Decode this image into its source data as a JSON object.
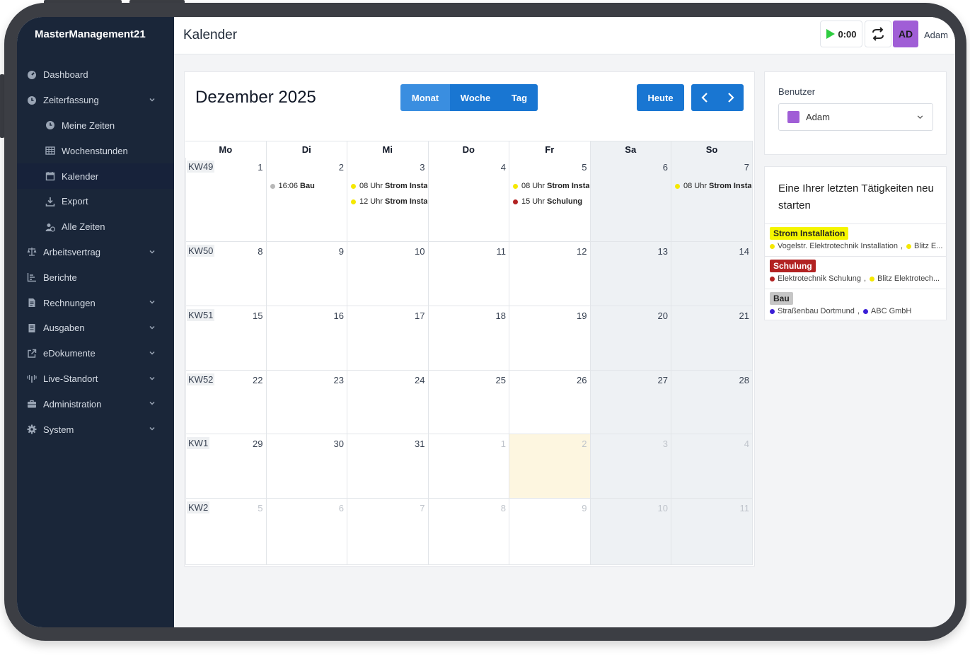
{
  "app": {
    "brand": "MasterManagement21",
    "page_title": "Kalender"
  },
  "sidebar": {
    "items": [
      {
        "label": "Dashboard",
        "icon": "dashboard-icon"
      },
      {
        "label": "Zeiterfassung",
        "icon": "clock-icon"
      },
      {
        "label": "Meine Zeiten",
        "icon": "clock-icon"
      },
      {
        "label": "Wochenstunden",
        "icon": "table-icon"
      },
      {
        "label": "Kalender",
        "icon": "calendar-icon"
      },
      {
        "label": "Export",
        "icon": "download-icon"
      },
      {
        "label": "Alle Zeiten",
        "icon": "users-icon"
      },
      {
        "label": "Arbeitsvertrag",
        "icon": "scale-icon"
      },
      {
        "label": "Berichte",
        "icon": "chart-icon"
      },
      {
        "label": "Rechnungen",
        "icon": "invoice-icon"
      },
      {
        "label": "Ausgaben",
        "icon": "receipt-icon"
      },
      {
        "label": "eDokumente",
        "icon": "external-link-icon"
      },
      {
        "label": "Live-Standort",
        "icon": "antenna-icon"
      },
      {
        "label": "Administration",
        "icon": "briefcase-icon"
      },
      {
        "label": "System",
        "icon": "gear-icon"
      }
    ]
  },
  "topbar": {
    "timer": "0:00",
    "avatar_initials": "AD",
    "user_name": "Adam"
  },
  "calendar": {
    "month_title": "Dezember 2025",
    "views": [
      "Monat",
      "Woche",
      "Tag"
    ],
    "today_label": "Heute",
    "weekdays": [
      "Mo",
      "Di",
      "Mi",
      "Do",
      "Fr",
      "Sa",
      "So"
    ],
    "weeks": [
      {
        "kw": "KW49",
        "days": [
          "1",
          "2",
          "3",
          "4",
          "5",
          "6",
          "7"
        ]
      },
      {
        "kw": "KW50",
        "days": [
          "8",
          "9",
          "10",
          "11",
          "12",
          "13",
          "14"
        ]
      },
      {
        "kw": "KW51",
        "days": [
          "15",
          "16",
          "17",
          "18",
          "19",
          "20",
          "21"
        ]
      },
      {
        "kw": "KW52",
        "days": [
          "22",
          "23",
          "24",
          "25",
          "26",
          "27",
          "28"
        ]
      },
      {
        "kw": "KW1",
        "days": [
          "29",
          "30",
          "31",
          "1",
          "2",
          "3",
          "4"
        ]
      },
      {
        "kw": "KW2",
        "days": [
          "5",
          "6",
          "7",
          "8",
          "9",
          "10",
          "11"
        ]
      }
    ],
    "events": [
      {
        "week": 0,
        "day": 1,
        "slot": 0,
        "time": "16:06",
        "title": "Bau",
        "color": "#b8b8b8"
      },
      {
        "week": 0,
        "day": 2,
        "slot": 0,
        "time": "08 Uhr",
        "title": "Strom Insta",
        "color": "#f5e800"
      },
      {
        "week": 0,
        "day": 2,
        "slot": 1,
        "time": "12 Uhr",
        "title": "Strom Insta",
        "color": "#f5e800"
      },
      {
        "week": 0,
        "day": 4,
        "slot": 0,
        "time": "08 Uhr",
        "title": "Strom Insta",
        "color": "#f5e800"
      },
      {
        "week": 0,
        "day": 4,
        "slot": 1,
        "time": "15 Uhr",
        "title": "Schulung",
        "color": "#b22222"
      },
      {
        "week": 0,
        "day": 6,
        "slot": 0,
        "time": "08 Uhr",
        "title": "Strom Insta",
        "color": "#f5e800"
      }
    ]
  },
  "user_panel": {
    "label": "Benutzer",
    "selected": "Adam"
  },
  "recent": {
    "title": "Eine Ihrer letzten Tätigkeiten neu starten",
    "items": [
      {
        "badge": "Strom Installation",
        "badge_bg": "#f5f500",
        "badge_fg": "#222",
        "p1": "Vogelstr. Elektrotechnik Installation",
        "c1": "#f5e800",
        "p2": "Blitz E...",
        "c2": "#f5e800"
      },
      {
        "badge": "Schulung",
        "badge_bg": "#b22222",
        "badge_fg": "#fff",
        "p1": "Elektrotechnik Schulung",
        "c1": "#b22222",
        "p2": "Blitz Elektrotech...",
        "c2": "#f5e800"
      },
      {
        "badge": "Bau",
        "badge_bg": "#c6c6c6",
        "badge_fg": "#222",
        "p1": "Straßenbau Dortmund",
        "c1": "#3b1fd6",
        "p2": "ABC GmbH",
        "c2": "#3b1fd6"
      }
    ]
  },
  "colors": {
    "sidebar_bg": "#1a2639",
    "primary": "#1976d2",
    "primary_dark": "#1565c0",
    "active_view": "#3a8ee0"
  }
}
